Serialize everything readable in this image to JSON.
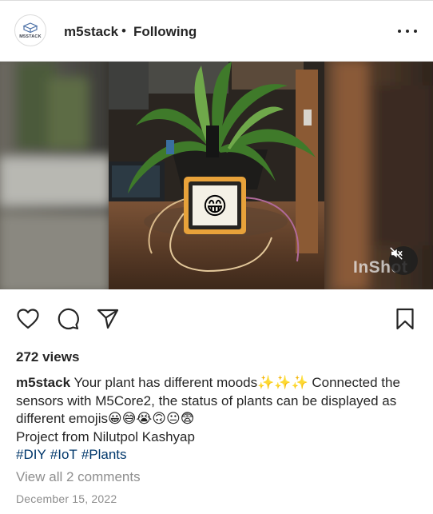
{
  "header": {
    "username": "m5stack",
    "separator": "•",
    "follow_state": "Following",
    "avatar_logo_text": "M5STACK",
    "more_icon": "more-horizontal-icon"
  },
  "media": {
    "watermark": "InShot",
    "mute_icon": "speaker-muted-icon",
    "screen_emoji": "😁"
  },
  "actions": {
    "like_icon": "heart-icon",
    "comment_icon": "comment-bubble-icon",
    "share_icon": "paper-plane-icon",
    "save_icon": "bookmark-icon"
  },
  "post": {
    "views": "272 views",
    "caption_user": "m5stack",
    "caption_line1": " Your plant has different moods✨✨✨ Connected the",
    "caption_line2": "sensors with M5Core2, the status of plants can be displayed as",
    "caption_line3": "different emojis😀😅😭🙃😐😨",
    "caption_line4": "Project from Nilutpol Kashyap",
    "hashtags": [
      "#DIY",
      "#IoT",
      "#Plants"
    ],
    "view_comments": "View all 2 comments",
    "date": "December 15, 2022"
  },
  "colors": {
    "text": "#262626",
    "muted": "#8e8e8e",
    "link": "#00376b"
  }
}
